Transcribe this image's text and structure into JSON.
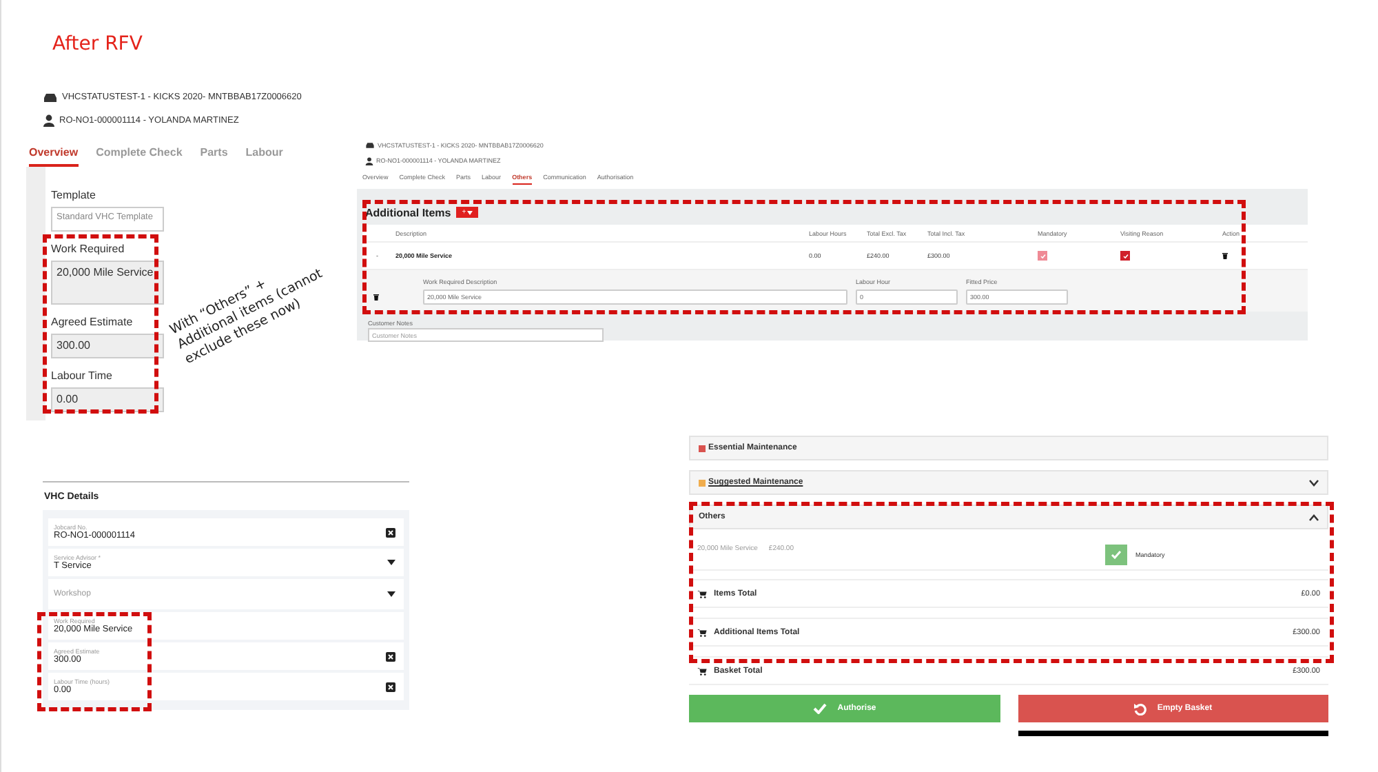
{
  "title": "After RFV",
  "overview": {
    "vehicle": "VHCSTATUSTEST-1 - KICKS 2020- MNTBBAB17Z0006620",
    "customer": "RO-NO1-000001114 - YOLANDA MARTINEZ",
    "tabs": [
      {
        "label": "Overview",
        "selected": true
      },
      {
        "label": "Complete Check",
        "selected": false
      },
      {
        "label": "Parts",
        "selected": false
      },
      {
        "label": "Labour",
        "selected": false
      }
    ],
    "fields": [
      {
        "label": "Template",
        "value": "Standard VHC Template",
        "kind": "select"
      },
      {
        "label": "Work Required",
        "value": "20,000 Mile Service",
        "kind": "textarea"
      },
      {
        "label": "Agreed Estimate",
        "value": "300.00",
        "kind": "input"
      },
      {
        "label": "Labour Time",
        "value": "0.00",
        "kind": "input"
      }
    ]
  },
  "annotation": "With “Others” + Additional items (cannot exclude these now)",
  "others": {
    "vehicle": "VHCSTATUSTEST-1 - KICKS 2020- MNTBBAB17Z0006620",
    "customer": "RO-NO1-000001114 - YOLANDA MARTINEZ",
    "tabs": [
      {
        "label": "Overview",
        "selected": false
      },
      {
        "label": "Complete Check",
        "selected": false
      },
      {
        "label": "Parts",
        "selected": false
      },
      {
        "label": "Labour",
        "selected": false
      },
      {
        "label": "Others",
        "selected": true
      },
      {
        "label": "Communication",
        "selected": false
      },
      {
        "label": "Authorisation",
        "selected": false
      }
    ],
    "section_title": "Additional Items",
    "add_button": "+",
    "columns": [
      "Description",
      "Labour Hours",
      "Total Excl. Tax",
      "Total Incl. Tax",
      "Mandatory",
      "Visiting Reason",
      "Action"
    ],
    "rows": [
      {
        "toggle": "-",
        "description": "20,000 Mile Service",
        "labour_hours": "0.00",
        "total_excl": "£240.00",
        "total_incl": "£300.00",
        "mandatory": true,
        "visiting_reason": true
      }
    ],
    "detail": [
      {
        "label": "Work Required Description",
        "value": "20,000 Mile Service"
      },
      {
        "label": "Labour Hour",
        "value": "0"
      },
      {
        "label": "Fitted Price",
        "value": "300.00"
      }
    ],
    "notes_label": "Customer Notes",
    "notes_placeholder": "Customer Notes"
  },
  "vhc": {
    "title": "VHC Details",
    "fields": [
      {
        "label": "Jobcard No.",
        "value": "RO-NO1-000001114",
        "kind": "clear"
      },
      {
        "label": "Service Advisor *",
        "value": "T Service",
        "kind": "select"
      },
      {
        "label": "Workshop",
        "kind": "select"
      },
      {
        "label": "Work Required",
        "value": "20,000 Mile Service",
        "kind": "plain"
      },
      {
        "label": "Agreed Estimate",
        "value": "300.00",
        "kind": "clear"
      },
      {
        "label": "Labour Time (hours)",
        "value": "0.00",
        "kind": "clear"
      }
    ]
  },
  "basket": {
    "sections": [
      {
        "title": "Essential Maintenance",
        "color": "#d9534f",
        "kind": "header"
      },
      {
        "title": "Suggested Maintenance",
        "color": "#f0ad4e",
        "kind": "link",
        "expanded": false
      },
      {
        "title": "Others",
        "kind": "header",
        "expanded": true
      }
    ],
    "others_item": {
      "description": "20,000 Mile Service",
      "price": "£240.00",
      "mandatory": true,
      "mandatory_label": "Mandatory"
    },
    "totals": [
      {
        "label": "Items Total",
        "value": "£0.00"
      },
      {
        "label": "Additional Items Total",
        "value": "£300.00"
      },
      {
        "label": "Basket Total",
        "value": "£300.00"
      }
    ],
    "buttons": [
      {
        "label": "Authorise",
        "kind": "authorise"
      },
      {
        "label": "Empty Basket",
        "kind": "empty"
      }
    ]
  }
}
